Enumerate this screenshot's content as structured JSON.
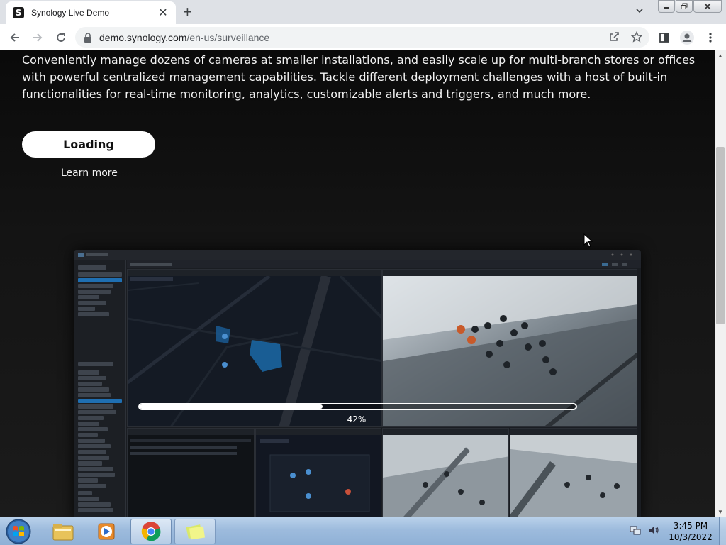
{
  "browser": {
    "tab": {
      "favicon": "S",
      "title": "Synology Live Demo",
      "close_icon": "close-icon"
    },
    "new_tab_icon": "plus-icon",
    "url_host": "demo.synology.com",
    "url_path": "/en-us/surveillance",
    "window_controls": [
      "minimize",
      "restore",
      "close"
    ]
  },
  "page": {
    "description": "Conveniently manage dozens of cameras at smaller installations, and easily scale up for multi-branch stores or offices with powerful centralized management capabilities. Tackle different deployment challenges with a host of built-in functionalities for real-time monitoring, analytics, customizable alerts and triggers, and much more.",
    "loading_button": "Loading",
    "learn_more": "Learn more",
    "progress": {
      "percent": 42,
      "label": "42%"
    }
  },
  "taskbar": {
    "items": [
      "windows-explorer",
      "media-player",
      "google-chrome",
      "sticky-notes"
    ],
    "active_item": "google-chrome",
    "clock": {
      "time": "3:45 PM",
      "date": "10/3/2022"
    }
  },
  "colors": {
    "page_bg": "#141414",
    "button_bg": "#ffffff",
    "taskbar": "#9dbbdd",
    "selection_blue": "#1f6fb2"
  }
}
